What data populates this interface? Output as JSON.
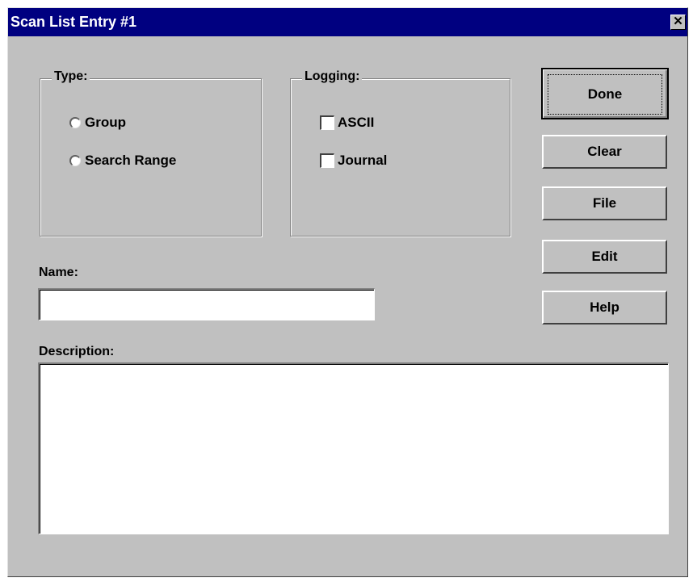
{
  "window": {
    "title": "Scan List Entry #1",
    "close_glyph": "✕"
  },
  "type_group": {
    "label": "Type:",
    "options": [
      {
        "label": "Group",
        "selected": false
      },
      {
        "label": "Search Range",
        "selected": false
      }
    ]
  },
  "logging_group": {
    "label": "Logging:",
    "options": [
      {
        "label": "ASCII",
        "checked": false
      },
      {
        "label": "Journal",
        "checked": false
      }
    ]
  },
  "buttons": {
    "done": "Done",
    "clear": "Clear",
    "file": "File",
    "edit": "Edit",
    "help": "Help"
  },
  "name": {
    "label": "Name:",
    "value": ""
  },
  "description": {
    "label": "Description:",
    "value": ""
  },
  "colors": {
    "titlebar": "#000080",
    "face": "#c0c0c0"
  }
}
